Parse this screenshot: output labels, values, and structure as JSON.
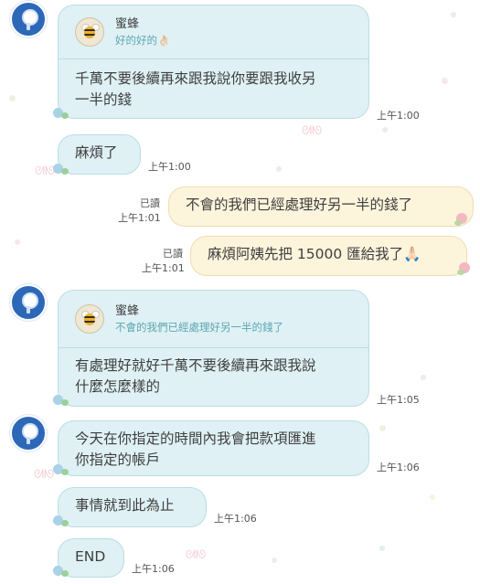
{
  "chat": {
    "messages": [
      {
        "reply_to": {
          "name": "蜜蜂",
          "text": "好的好的👌🏻"
        },
        "text": "千萬不要後續再來跟我說你要跟我收另\n一半的錢",
        "time": "上午1:00"
      },
      {
        "text": "麻煩了",
        "time": "上午1:00"
      },
      {
        "text": "不會的我們已經處理好另一半的錢了",
        "time": "上午1:01",
        "read": "已讀"
      },
      {
        "text": "麻煩阿姨先把 15000 匯給我了🙏🏻",
        "time": "上午1:01",
        "read": "已讀"
      },
      {
        "reply_to": {
          "name": "蜜蜂",
          "text": "不會的我們已經處理好另一半的錢了"
        },
        "text": "有處理好就好千萬不要後續再來跟我說\n什麼怎麼樣的",
        "time": "上午1:05"
      },
      {
        "text": "今天在你指定的時間內我會把款項匯進\n你指定的帳戶",
        "time": "上午1:06"
      },
      {
        "text": "事情就到此為止",
        "time": "上午1:06"
      },
      {
        "text": "END",
        "time": "上午1:06"
      }
    ]
  },
  "theme": {
    "bubble_left": "#dff1f4",
    "bubble_right": "#fdf4dc",
    "reply_accent": "#5ba6b2",
    "avatar_color": "#2d68b8"
  }
}
